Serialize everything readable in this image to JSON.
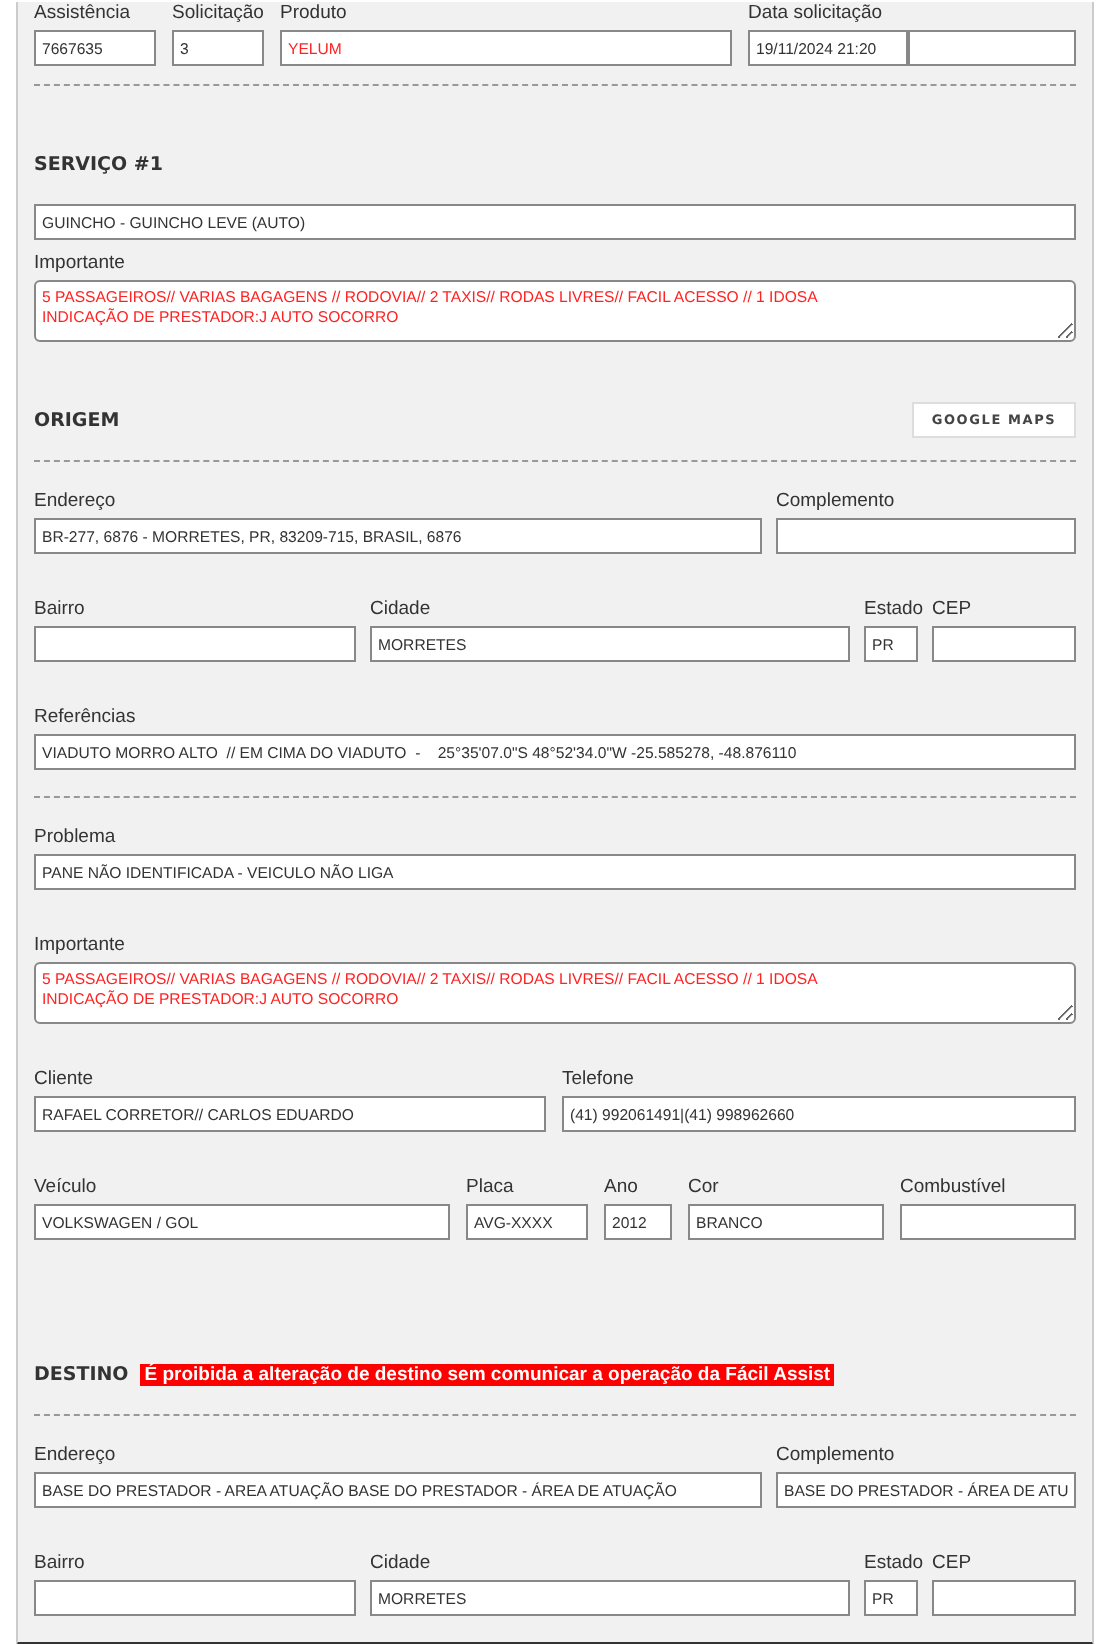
{
  "sections": [
    {
      "kind": "row",
      "fields": [
        {
          "kind": "text",
          "label": "Assistência",
          "value": "7667635"
        },
        {
          "kind": "text",
          "label": "Solicitação",
          "value": "3"
        },
        {
          "kind": "text",
          "label": "Produto",
          "value": "YELUM",
          "warning": true
        },
        {
          "kind": "text",
          "label": "Data solicitação",
          "value": "19/11/2024 21:20"
        },
        {
          "kind": "blank"
        }
      ]
    },
    {
      "kind": "rule"
    },
    {
      "kind": "heading",
      "title": "SERVIÇO #1"
    },
    {
      "kind": "row",
      "fields": [
        {
          "kind": "text",
          "value": "GUINCHO - GUINCHO LEVE (AUTO)"
        }
      ]
    },
    {
      "kind": "row",
      "fields": [
        {
          "kind": "multiline",
          "label": "Importante",
          "warning": true,
          "value": "5 PASSAGEIROS// VARIAS BAGAGENS // RODOVIA// 2 TAXIS// RODAS LIVRES// FACIL ACESSO // 1 IDOSA\nINDICAÇÃO DE PRESTADOR:J AUTO SOCORRO"
        }
      ]
    },
    {
      "kind": "heading",
      "title": "ORIGEM",
      "button": "GOOGLE MAPS"
    },
    {
      "kind": "rule"
    },
    {
      "kind": "row",
      "fields": [
        {
          "kind": "text",
          "label": "Endereço",
          "value": "BR-277, 6876 - MORRETES, PR, 83209-715, BRASIL, 6876"
        },
        {
          "kind": "text",
          "label": "Complemento"
        }
      ]
    },
    {
      "kind": "row",
      "fields": [
        {
          "kind": "text",
          "label": "Bairro"
        },
        {
          "kind": "text",
          "label": "Cidade",
          "value": "MORRETES"
        },
        {
          "kind": "text",
          "label": "Estado",
          "value": "PR"
        },
        {
          "kind": "text",
          "label": "CEP"
        }
      ]
    },
    {
      "kind": "row",
      "fields": [
        {
          "kind": "text",
          "label": "Referências",
          "value": "VIADUTO MORRO ALTO  // EM CIMA DO VIADUTO  -    25°35'07.0\"S 48°52'34.0\"W -25.585278, -48.876110"
        }
      ]
    },
    {
      "kind": "rule"
    },
    {
      "kind": "row",
      "fields": [
        {
          "kind": "text",
          "label": "Problema",
          "value": "PANE NÃO IDENTIFICADA - VEICULO NÃO LIGA"
        }
      ]
    },
    {
      "kind": "row",
      "fields": [
        {
          "kind": "multiline",
          "label": "Importante",
          "warning": true,
          "value": "5 PASSAGEIROS// VARIAS BAGAGENS // RODOVIA// 2 TAXIS// RODAS LIVRES// FACIL ACESSO // 1 IDOSA\nINDICAÇÃO DE PRESTADOR:J AUTO SOCORRO"
        }
      ]
    },
    {
      "kind": "row",
      "fields": [
        {
          "kind": "text",
          "label": "Cliente",
          "value": "RAFAEL CORRETOR// CARLOS EDUARDO"
        },
        {
          "kind": "text",
          "label": "Telefone",
          "value": "(41) 992061491|(41) 998962660"
        }
      ]
    },
    {
      "kind": "row",
      "fields": [
        {
          "kind": "text",
          "label": "Veículo",
          "value": "VOLKSWAGEN / GOL"
        },
        {
          "kind": "text",
          "label": "Placa",
          "value": "AVG-XXXX"
        },
        {
          "kind": "text",
          "label": "Ano",
          "value": "2012"
        },
        {
          "kind": "text",
          "label": "Cor",
          "value": "BRANCO"
        },
        {
          "kind": "text",
          "label": "Combustível"
        }
      ]
    },
    {
      "kind": "heading",
      "title": "DESTINO",
      "notice": "É proibida a alteração de destino sem comunicar a operação da Fácil Assist"
    },
    {
      "kind": "rule"
    },
    {
      "kind": "row",
      "fields": [
        {
          "kind": "text",
          "label": "Endereço",
          "value": "BASE DO PRESTADOR - AREA ATUAÇÃO BASE DO PRESTADOR - ÁREA DE ATUAÇÃO"
        },
        {
          "kind": "text",
          "label": "Complemento",
          "value": "BASE DO PRESTADOR - ÁREA DE ATU"
        }
      ]
    },
    {
      "kind": "row",
      "fields": [
        {
          "kind": "text",
          "label": "Bairro"
        },
        {
          "kind": "text",
          "label": "Cidade",
          "value": "MORRETES"
        },
        {
          "kind": "text",
          "label": "Estado",
          "value": "PR"
        },
        {
          "kind": "text",
          "label": "CEP"
        }
      ]
    }
  ]
}
